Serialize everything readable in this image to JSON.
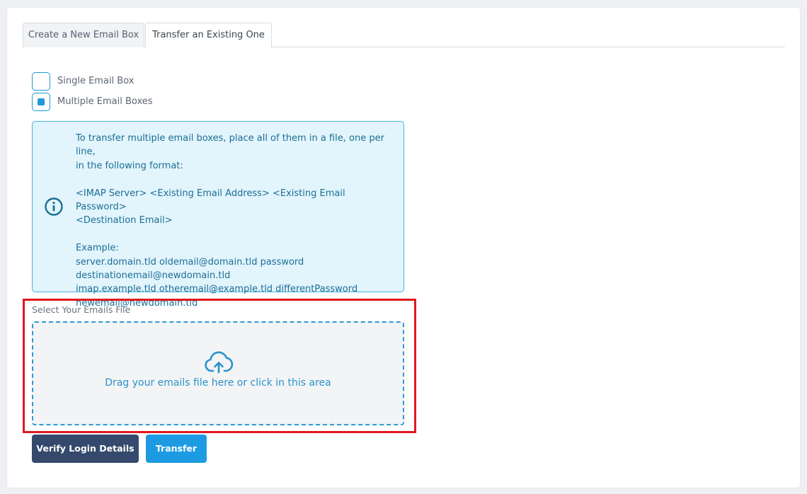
{
  "tabs": {
    "create": "Create a New Email Box",
    "transfer": "Transfer an Existing One"
  },
  "options": {
    "single": {
      "label": "Single Email Box",
      "checked": false
    },
    "multiple": {
      "label": "Multiple Email Boxes",
      "checked": true
    }
  },
  "info": {
    "lines": [
      "To transfer multiple email boxes, place all of them in a file, one per line,",
      "in the following format:",
      "",
      "<IMAP Server> <Existing Email Address> <Existing Email Password>",
      "<Destination Email>",
      "",
      "Example:",
      "server.domain.tld oldemail@domain.tld password",
      "destinationemail@newdomain.tld",
      "imap.example.tld otheremail@example.tld differentPassword",
      "newemail@newdomain.tld"
    ]
  },
  "file_select": {
    "label": "Select Your Emails File",
    "dropzone_text": "Drag your emails file here or click in this area"
  },
  "buttons": {
    "verify": "Verify Login Details",
    "transfer": "Transfer"
  },
  "colors": {
    "accent": "#1e9ad6",
    "primary_dark": "#34496c",
    "primary_blue": "#1d9be2",
    "info_bg": "#e2f4fc",
    "highlight": "#e0191f"
  }
}
